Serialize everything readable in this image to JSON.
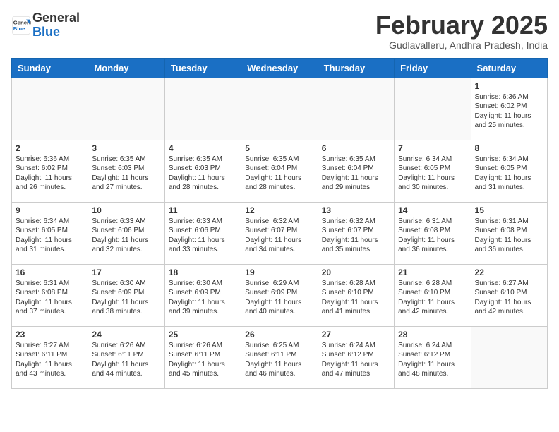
{
  "header": {
    "logo_line1": "General",
    "logo_line2": "Blue",
    "month_title": "February 2025",
    "location": "Gudlavalleru, Andhra Pradesh, India"
  },
  "weekdays": [
    "Sunday",
    "Monday",
    "Tuesday",
    "Wednesday",
    "Thursday",
    "Friday",
    "Saturday"
  ],
  "weeks": [
    [
      {
        "day": "",
        "info": ""
      },
      {
        "day": "",
        "info": ""
      },
      {
        "day": "",
        "info": ""
      },
      {
        "day": "",
        "info": ""
      },
      {
        "day": "",
        "info": ""
      },
      {
        "day": "",
        "info": ""
      },
      {
        "day": "1",
        "info": "Sunrise: 6:36 AM\nSunset: 6:02 PM\nDaylight: 11 hours and 25 minutes."
      }
    ],
    [
      {
        "day": "2",
        "info": "Sunrise: 6:36 AM\nSunset: 6:02 PM\nDaylight: 11 hours and 26 minutes."
      },
      {
        "day": "3",
        "info": "Sunrise: 6:35 AM\nSunset: 6:03 PM\nDaylight: 11 hours and 27 minutes."
      },
      {
        "day": "4",
        "info": "Sunrise: 6:35 AM\nSunset: 6:03 PM\nDaylight: 11 hours and 28 minutes."
      },
      {
        "day": "5",
        "info": "Sunrise: 6:35 AM\nSunset: 6:04 PM\nDaylight: 11 hours and 28 minutes."
      },
      {
        "day": "6",
        "info": "Sunrise: 6:35 AM\nSunset: 6:04 PM\nDaylight: 11 hours and 29 minutes."
      },
      {
        "day": "7",
        "info": "Sunrise: 6:34 AM\nSunset: 6:05 PM\nDaylight: 11 hours and 30 minutes."
      },
      {
        "day": "8",
        "info": "Sunrise: 6:34 AM\nSunset: 6:05 PM\nDaylight: 11 hours and 31 minutes."
      }
    ],
    [
      {
        "day": "9",
        "info": "Sunrise: 6:34 AM\nSunset: 6:05 PM\nDaylight: 11 hours and 31 minutes."
      },
      {
        "day": "10",
        "info": "Sunrise: 6:33 AM\nSunset: 6:06 PM\nDaylight: 11 hours and 32 minutes."
      },
      {
        "day": "11",
        "info": "Sunrise: 6:33 AM\nSunset: 6:06 PM\nDaylight: 11 hours and 33 minutes."
      },
      {
        "day": "12",
        "info": "Sunrise: 6:32 AM\nSunset: 6:07 PM\nDaylight: 11 hours and 34 minutes."
      },
      {
        "day": "13",
        "info": "Sunrise: 6:32 AM\nSunset: 6:07 PM\nDaylight: 11 hours and 35 minutes."
      },
      {
        "day": "14",
        "info": "Sunrise: 6:31 AM\nSunset: 6:08 PM\nDaylight: 11 hours and 36 minutes."
      },
      {
        "day": "15",
        "info": "Sunrise: 6:31 AM\nSunset: 6:08 PM\nDaylight: 11 hours and 36 minutes."
      }
    ],
    [
      {
        "day": "16",
        "info": "Sunrise: 6:31 AM\nSunset: 6:08 PM\nDaylight: 11 hours and 37 minutes."
      },
      {
        "day": "17",
        "info": "Sunrise: 6:30 AM\nSunset: 6:09 PM\nDaylight: 11 hours and 38 minutes."
      },
      {
        "day": "18",
        "info": "Sunrise: 6:30 AM\nSunset: 6:09 PM\nDaylight: 11 hours and 39 minutes."
      },
      {
        "day": "19",
        "info": "Sunrise: 6:29 AM\nSunset: 6:09 PM\nDaylight: 11 hours and 40 minutes."
      },
      {
        "day": "20",
        "info": "Sunrise: 6:28 AM\nSunset: 6:10 PM\nDaylight: 11 hours and 41 minutes."
      },
      {
        "day": "21",
        "info": "Sunrise: 6:28 AM\nSunset: 6:10 PM\nDaylight: 11 hours and 42 minutes."
      },
      {
        "day": "22",
        "info": "Sunrise: 6:27 AM\nSunset: 6:10 PM\nDaylight: 11 hours and 42 minutes."
      }
    ],
    [
      {
        "day": "23",
        "info": "Sunrise: 6:27 AM\nSunset: 6:11 PM\nDaylight: 11 hours and 43 minutes."
      },
      {
        "day": "24",
        "info": "Sunrise: 6:26 AM\nSunset: 6:11 PM\nDaylight: 11 hours and 44 minutes."
      },
      {
        "day": "25",
        "info": "Sunrise: 6:26 AM\nSunset: 6:11 PM\nDaylight: 11 hours and 45 minutes."
      },
      {
        "day": "26",
        "info": "Sunrise: 6:25 AM\nSunset: 6:11 PM\nDaylight: 11 hours and 46 minutes."
      },
      {
        "day": "27",
        "info": "Sunrise: 6:24 AM\nSunset: 6:12 PM\nDaylight: 11 hours and 47 minutes."
      },
      {
        "day": "28",
        "info": "Sunrise: 6:24 AM\nSunset: 6:12 PM\nDaylight: 11 hours and 48 minutes."
      },
      {
        "day": "",
        "info": ""
      }
    ]
  ]
}
